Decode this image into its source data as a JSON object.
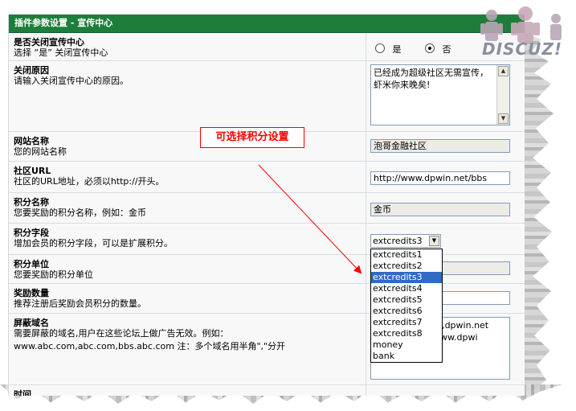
{
  "panel": {
    "title": "插件参数设置 - 宣传中心"
  },
  "callout": {
    "text": "可选择积分设置"
  },
  "logo": {
    "text": "DISCUZ!"
  },
  "rows": [
    {
      "label": "是否关闭宣传中心",
      "desc": "选择 “是” 关闭宣传中心"
    },
    {
      "label": "关闭原因",
      "desc": "请输入关闭宣传中心的原因。"
    },
    {
      "label": "网站名称",
      "desc": "您的网站名称"
    },
    {
      "label": "社区URL",
      "desc": "社区的URL地址，必须以http://开头。"
    },
    {
      "label": "积分名称",
      "desc": "您要奖励的积分名称，例如：金币"
    },
    {
      "label": "积分字段",
      "desc": "增加会员的积分字段，可以是扩展积分。"
    },
    {
      "label": "积分单位",
      "desc": "您要奖励的积分单位"
    },
    {
      "label": "奖励数量",
      "desc": "推荐注册后奖励会员积分的数量。"
    },
    {
      "label": "屏蔽域名",
      "desc": "需要屏蔽的域名,用户在这些论坛上做广告无效。例如：",
      "desc2": "www.abc.com,abc.com,bbs.abc.com 注：多个域名用半角\",\"分开"
    },
    {
      "label": "时间"
    }
  ],
  "close_radio": {
    "yes": "是",
    "no": "否",
    "selected": "否"
  },
  "close_reason": {
    "value": "已经成为超级社区无需宣传，虾米你来晚矣!"
  },
  "site_name": {
    "value": "泡哥金融社区"
  },
  "site_url": {
    "value": "http://www.dpwin.net/bbs"
  },
  "credit_name": {
    "value": "金币"
  },
  "credit_field": {
    "selected": "extcredits3",
    "options": [
      "extcredits1",
      "extcredits2",
      "extcredits3",
      "extcredits4",
      "extcredits5",
      "extcredits6",
      "extcredits7",
      "extcredits8",
      "money",
      "bank"
    ]
  },
  "blocked_domains": {
    "line1": "et,dpwin.net",
    "line2": "www.dpwi"
  },
  "colors": {
    "header_green": "#1e7d3a",
    "callout_red": "#ff0000",
    "selection_blue": "#316ac5"
  }
}
